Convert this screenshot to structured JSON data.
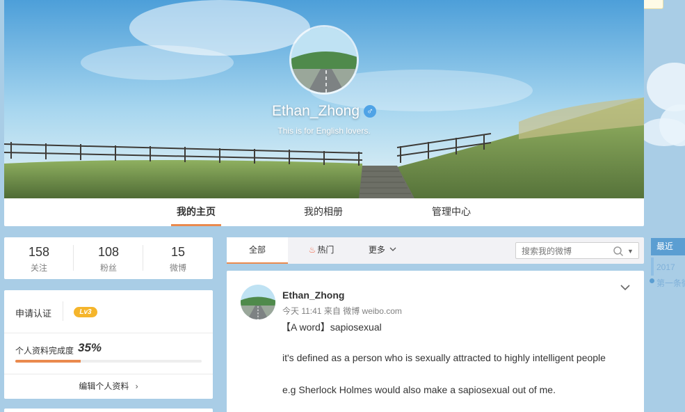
{
  "profile": {
    "name": "Ethan_Zhong",
    "gender_symbol": "♂",
    "bio": "This is for English lovers."
  },
  "nav": {
    "items": [
      {
        "label": "我的主页"
      },
      {
        "label": "我的相册"
      },
      {
        "label": "管理中心"
      }
    ]
  },
  "stats": [
    {
      "value": "158",
      "label": "关注"
    },
    {
      "value": "108",
      "label": "粉丝"
    },
    {
      "value": "15",
      "label": "微博"
    }
  ],
  "verify": {
    "apply_label": "申请认证",
    "level": "Lv3",
    "completion_label": "个人资料完成度",
    "completion_value": "35%",
    "completion_fraction": 0.35,
    "edit_label": "编辑个人资料"
  },
  "feed_tabs": {
    "all": "全部",
    "hot": "热门",
    "more": "更多"
  },
  "search": {
    "placeholder": "搜索我的微博"
  },
  "post": {
    "author": "Ethan_Zhong",
    "time": "今天 11:41",
    "source_prefix": "来自",
    "source": "微博 weibo.com",
    "lines": [
      "【A word】sapiosexual",
      "it's defined as a person who is sexually attracted to highly intelligent people",
      "e.g Sherlock Holmes would also make a sapiosexual out of me."
    ]
  },
  "sidebar": {
    "recent_label": "最近",
    "year": "2017",
    "first_item": "第一条微"
  },
  "colors": {
    "accent": "#ea8a4e",
    "page_bg": "#a9cde6",
    "level_badge": "#f5b52b",
    "gender_blue": "#4fa3e6"
  }
}
